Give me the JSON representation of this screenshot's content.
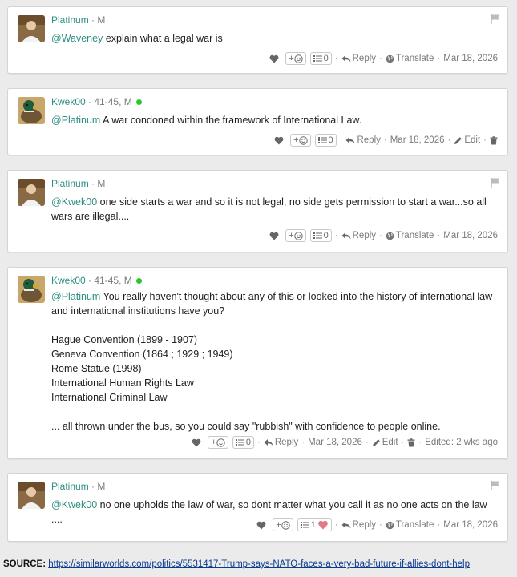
{
  "comments": [
    {
      "author": "Platinum",
      "meta": "· M",
      "online": false,
      "mention": "@Waveney",
      "text": " explain what a legal war is",
      "extra_lines": [],
      "reactions": "0",
      "owner_actions": false,
      "date": "Mar 18, 2026"
    },
    {
      "author": "Kwek00",
      "meta": "· 41-45, M",
      "online": true,
      "mention": "@Platinum",
      "text": " A war condoned within the framework of International Law.",
      "extra_lines": [],
      "reactions": "0",
      "owner_actions": true,
      "date": "Mar 18, 2026"
    },
    {
      "author": "Platinum",
      "meta": "· M",
      "online": false,
      "mention": "@Kwek00",
      "text": " one side starts a war and so it is not legal, no side gets permission to start a war...so all wars are illegal....",
      "extra_lines": [],
      "reactions": "0",
      "owner_actions": false,
      "date": "Mar 18, 2026"
    },
    {
      "author": "Kwek00",
      "meta": "· 41-45, M",
      "online": true,
      "mention": "@Platinum",
      "text": " You really haven't thought about any of this or looked into the history of international law and international institutions have you?",
      "extra_lines": [
        "",
        "Hague Convention (1899 - 1907)",
        "Geneva Convention (1864 ; 1929 ; 1949)",
        "Rome Statue (1998)",
        "International Human Rights Law",
        "International Criminal Law",
        "",
        "... all thrown under the bus, so you could say \"rubbish\" with confidence to people online."
      ],
      "reactions": "0",
      "owner_actions": true,
      "date": "Mar 18, 2026",
      "edited": "Edited: 2 wks ago"
    },
    {
      "author": "Platinum",
      "meta": "· M",
      "online": false,
      "mention": "@Kwek00",
      "text": " no one upholds the law of war, so dont matter what you call it as no one acts on the law ....",
      "extra_lines": [],
      "reactions": "1",
      "reaction_heart": true,
      "owner_actions": false,
      "date": "Mar 18, 2026"
    }
  ],
  "labels": {
    "add_reaction": "+",
    "reply": "Reply",
    "translate": "Translate",
    "edit": "Edit"
  },
  "source": {
    "label": "SOURCE:",
    "url": "https://similarworlds.com/politics/5531417-Trump-says-NATO-faces-a-very-bad-future-if-allies-dont-help"
  },
  "colors": {
    "username": "#2e8f84",
    "online_dot": "#2ec62e",
    "background": "#ebebeb"
  },
  "icons": {
    "like": "heart-icon",
    "react": "smiley-icon",
    "reaction_list": "list-icon",
    "reply": "reply-arrow-icon",
    "translate": "globe-icon",
    "edit": "pencil-icon",
    "delete": "trash-icon",
    "report": "flag-icon"
  }
}
